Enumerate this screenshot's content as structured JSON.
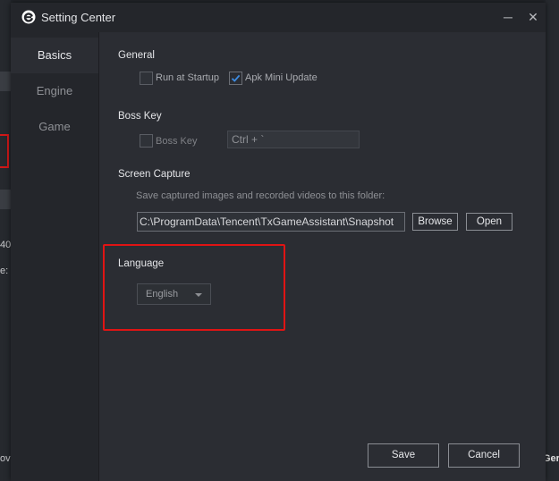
{
  "window": {
    "title": "Setting Center",
    "minimize_glyph": "─",
    "close_glyph": "✕"
  },
  "background": {
    "left_fragments": [
      "40",
      "e:",
      "ov"
    ],
    "right_fragment": "Ger"
  },
  "sidebar": {
    "items": [
      {
        "label": "Basics",
        "active": true
      },
      {
        "label": "Engine",
        "active": false
      },
      {
        "label": "Game",
        "active": false
      }
    ]
  },
  "general": {
    "title": "General",
    "run_at_startup": {
      "label": "Run at Startup",
      "checked": false
    },
    "apk_mini_update": {
      "label": "Apk Mini Update",
      "checked": true
    }
  },
  "boss_key": {
    "title": "Boss Key",
    "checkbox": {
      "label": "Boss Key",
      "checked": false
    },
    "shortcut_value": "Ctrl + `"
  },
  "screen_capture": {
    "title": "Screen Capture",
    "hint": "Save captured images and recorded videos to this folder:",
    "path": "C:\\ProgramData\\Tencent\\TxGameAssistant\\Snapshot",
    "browse_label": "Browse",
    "open_label": "Open"
  },
  "language": {
    "title": "Language",
    "selected": "English"
  },
  "footer": {
    "save_label": "Save",
    "cancel_label": "Cancel"
  },
  "colors": {
    "accent_check": "#3d8be0",
    "highlight": "#e01414"
  },
  "icons": {
    "app_logo": "app-logo-icon",
    "checkmark": "checkmark-icon",
    "dropdown": "chevron-down-icon"
  }
}
